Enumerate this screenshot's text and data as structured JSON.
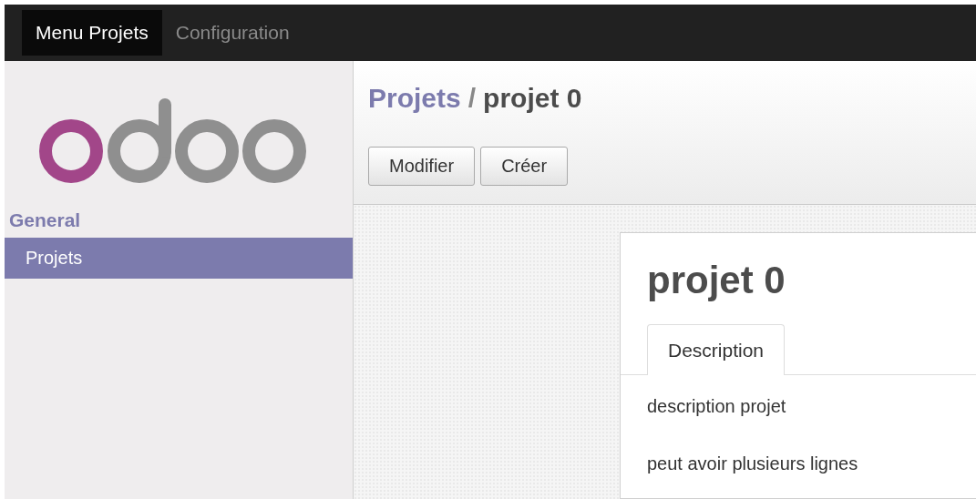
{
  "top_menu": [
    {
      "label": "Menu Projets",
      "selected": true
    },
    {
      "label": "Configuration",
      "selected": false
    }
  ],
  "sidebar": {
    "section": "General",
    "items": [
      {
        "label": "Projets",
        "selected": true
      }
    ]
  },
  "breadcrumb": {
    "parent": "Projets",
    "separator": "/",
    "current": "projet 0"
  },
  "buttons": [
    "Modifier",
    "Créer"
  ],
  "sheet": {
    "title": "projet 0",
    "tabs": [
      {
        "label": "Description",
        "selected": true
      }
    ],
    "lines": [
      "description projet",
      "peut avoir plusieurs lignes"
    ]
  }
}
